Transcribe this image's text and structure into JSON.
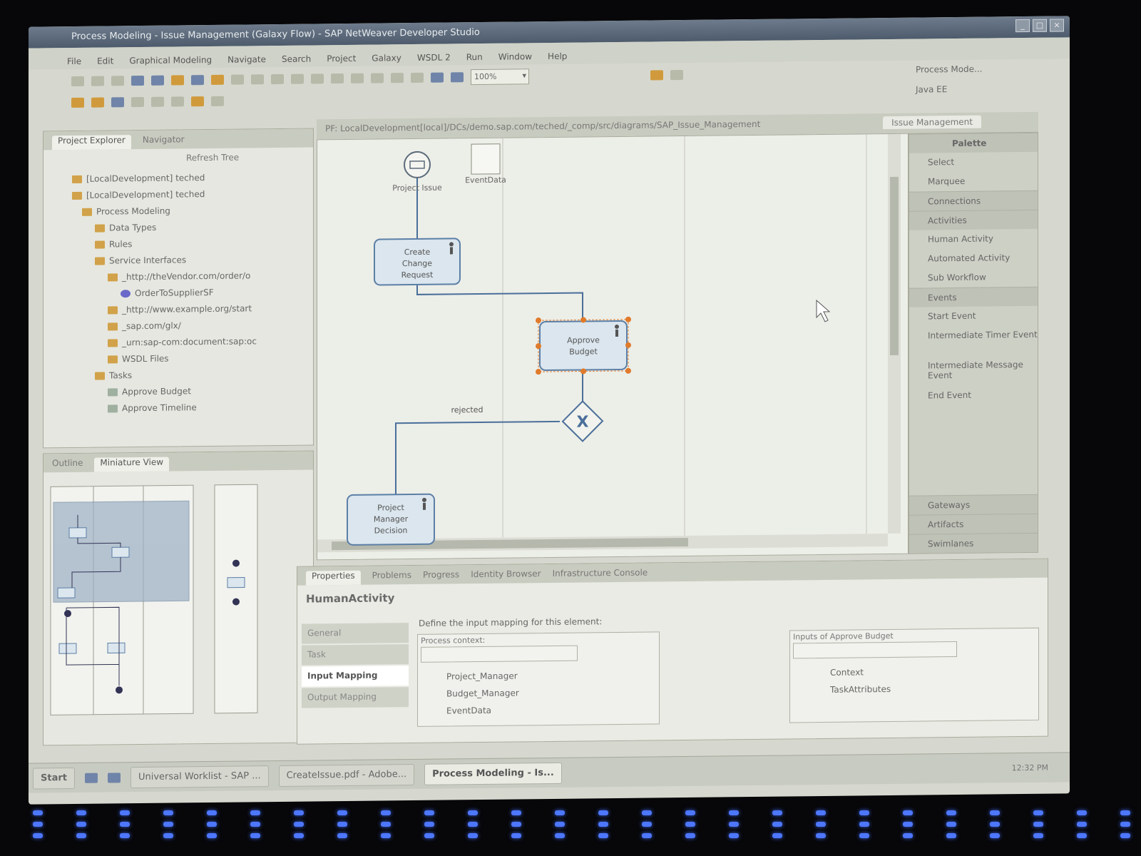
{
  "window": {
    "title": "Process Modeling - Issue Management (Galaxy Flow) - SAP NetWeaver Developer Studio"
  },
  "menu": [
    "File",
    "Edit",
    "Graphical Modeling",
    "Navigate",
    "Search",
    "Project",
    "Galaxy",
    "WSDL 2",
    "Run",
    "Window",
    "Help"
  ],
  "toolbar": {
    "zoom_value": "100%"
  },
  "perspectives": [
    "Process Mode...",
    "Java EE"
  ],
  "project_explorer": {
    "tabs": [
      "Project Explorer",
      "Navigator"
    ],
    "refresh_label": "Refresh Tree",
    "items": [
      "[LocalDevelopment] teched",
      "[LocalDevelopment] teched",
      "Process Modeling",
      "Data Types",
      "Rules",
      "Service Interfaces",
      "_http://theVendor.com/order/o",
      "OrderToSupplierSF",
      "_http://www.example.org/start",
      "_sap.com/glx/",
      "_urn:sap-com:document:sap:oc",
      "WSDL Files",
      "Tasks",
      "Approve Budget",
      "Approve Timeline"
    ]
  },
  "outline": {
    "tabs": [
      "Outline",
      "Miniature View"
    ]
  },
  "editor": {
    "path": "PF: LocalDevelopment[local]/DCs/demo.sap.com/teched/_comp/src/diagrams/SAP_Issue_Management",
    "tab": "Issue Management",
    "nodes": {
      "start_label": "Project Issue",
      "eventdata_label": "EventData",
      "create_change": [
        "Create",
        "Change",
        "Request"
      ],
      "approve_budget": [
        "Approve",
        "Budget"
      ],
      "pm_decision": [
        "Project",
        "Manager",
        "Decision"
      ],
      "gateway_symbol": "X",
      "rejected_label": "rejected"
    }
  },
  "palette": {
    "title": "Palette",
    "items": [
      {
        "label": "Select",
        "type": "item"
      },
      {
        "label": "Marquee",
        "type": "item"
      },
      {
        "label": "Connections",
        "type": "header"
      },
      {
        "label": "Activities",
        "type": "header"
      },
      {
        "label": "Human Activity",
        "type": "item"
      },
      {
        "label": "Automated Activity",
        "type": "item"
      },
      {
        "label": "Sub Workflow",
        "type": "item"
      },
      {
        "label": "Events",
        "type": "header"
      },
      {
        "label": "Start Event",
        "type": "item"
      },
      {
        "label": "Intermediate Timer Event",
        "type": "item"
      },
      {
        "label": "Intermediate Message Event",
        "type": "item"
      },
      {
        "label": "End Event",
        "type": "item"
      }
    ],
    "bottom": [
      "Gateways",
      "Artifacts",
      "Swimlanes"
    ]
  },
  "properties": {
    "tabs": [
      "Properties",
      "Problems",
      "Progress",
      "Identity Browser",
      "Infrastructure Console"
    ],
    "title": "HumanActivity",
    "side_tabs": [
      "General",
      "Task",
      "Input Mapping",
      "Output Mapping"
    ],
    "instruction": "Define the input mapping for this element:",
    "process_context_label": "Process context:",
    "process_context_items": [
      "Project_Manager",
      "Budget_Manager",
      "EventData"
    ],
    "inputs_label": "Inputs of Approve Budget",
    "inputs_items": [
      "Context",
      "TaskAttributes"
    ]
  },
  "taskbar": {
    "start": "Start",
    "buttons": [
      "Universal Worklist - SAP ...",
      "CreateIssue.pdf - Adobe...",
      "Process Modeling - Is..."
    ],
    "clock": "12:32 PM"
  },
  "colors": {
    "accent_orange": "#e07a2a",
    "node_fill": "#dbe6ee",
    "node_border": "#5c7fa6"
  }
}
